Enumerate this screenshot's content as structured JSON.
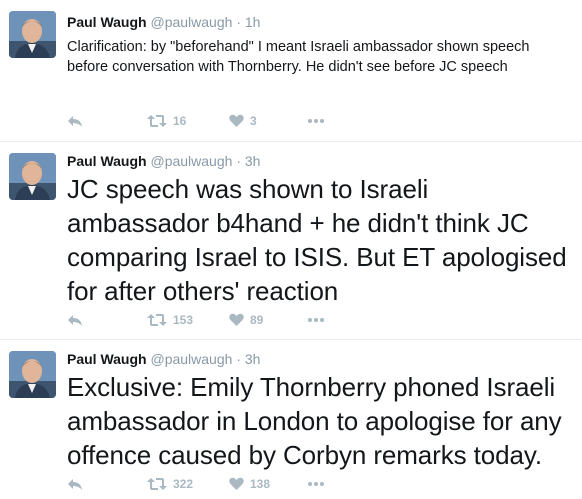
{
  "colors": {
    "icon": "#aab8c2",
    "muted": "#8899a6",
    "divider": "#e6ecf0",
    "text": "#14171a"
  },
  "tweets": [
    {
      "name": "Paul Waugh",
      "handle": "@paulwaugh",
      "dot": "·",
      "time": "1h",
      "text": "Clarification: by \"beforehand\" I meant Israeli ambassador shown speech before conversation with Thornberry. He didn't see before JC speech",
      "retweets": "16",
      "likes": "3"
    },
    {
      "name": "Paul Waugh",
      "handle": "@paulwaugh",
      "dot": "·",
      "time": "3h",
      "text": "JC speech was shown to Israeli ambassador b4hand + he didn't think JC comparing Israel to ISIS. But ET apologised for after others' reaction",
      "retweets": "153",
      "likes": "89"
    },
    {
      "name": "Paul Waugh",
      "handle": "@paulwaugh",
      "dot": "·",
      "time": "3h",
      "text": "Exclusive: Emily Thornberry phoned Israeli ambassador in London to apologise for any offence caused by Corbyn remarks today.",
      "retweets": "322",
      "likes": "138"
    }
  ],
  "icons": {
    "reply": "reply-icon",
    "retweet": "retweet-icon",
    "like": "heart-icon",
    "more": "more-icon",
    "avatar": "avatar"
  }
}
